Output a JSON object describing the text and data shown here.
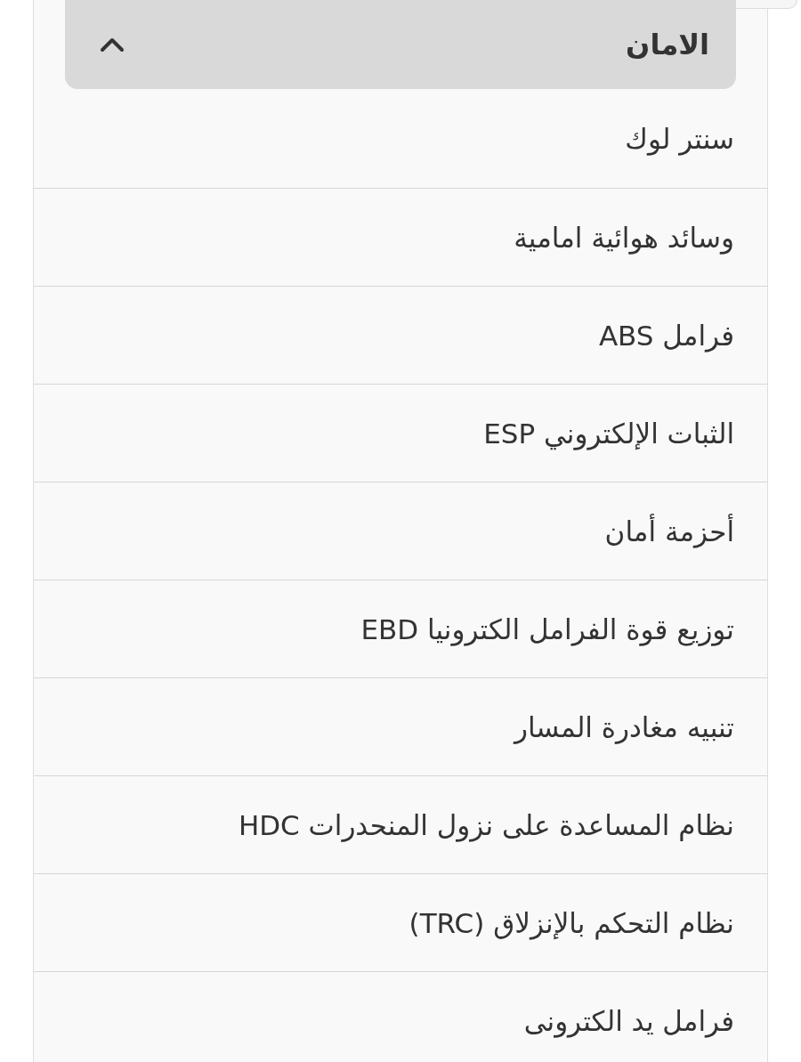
{
  "section": {
    "title": "الامان",
    "expanded": true
  },
  "items": [
    "سنتر لوك",
    "وسائد هوائية امامية",
    "فرامل ABS",
    "الثبات الإلكتروني ESP",
    "أحزمة أمان",
    "توزيع قوة الفرامل الكترونيا EBD",
    "تنبيه مغادرة المسار",
    "نظام المساعدة على نزول المنحدرات HDC",
    "نظام التحكم بالإنزلاق (TRC)",
    "فرامل يد الكترونى"
  ]
}
